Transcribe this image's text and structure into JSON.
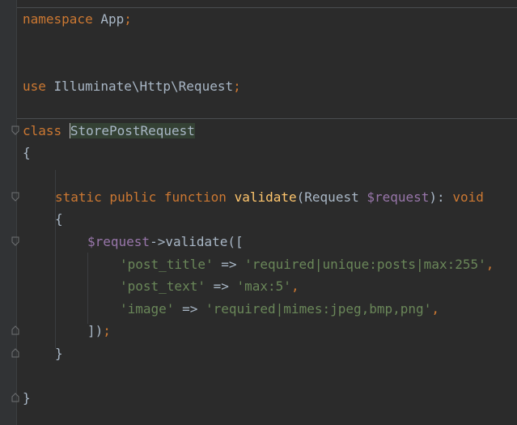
{
  "editor": {
    "lines": {
      "namespace_kw": "namespace",
      "namespace_name": " App",
      "namespace_semi": ";",
      "use_kw": "use",
      "use_path": " Illuminate\\Http\\Request",
      "use_semi": ";",
      "class_kw": "class",
      "class_space": " ",
      "class_name": "StorePostRequest",
      "open_brace": "{",
      "method_static": "static",
      "method_public": " public",
      "method_function": " function",
      "method_space": " ",
      "method_name": "validate",
      "method_paren_open": "(",
      "method_param_type": "Request ",
      "method_param_var": "$request",
      "method_paren_close": ")",
      "method_colon": ": ",
      "method_return": "void",
      "method_open_brace": "{",
      "call_var": "$request",
      "call_arrow": "->",
      "call_name": "validate",
      "call_open": "([",
      "rule1_key": "'post_title'",
      "rule1_arrow": " => ",
      "rule1_value": "'required|unique:posts|max:255'",
      "rule1_comma": ",",
      "rule2_key": "'post_text'",
      "rule2_arrow": " => ",
      "rule2_value": "'max:5'",
      "rule2_comma": ",",
      "rule3_key": "'image'",
      "rule3_arrow": " => ",
      "rule3_value": "'required|mimes:jpeg,bmp,png'",
      "rule3_comma": ",",
      "call_close": "])",
      "call_semi": ";",
      "method_close_brace": "}",
      "class_close_brace": "}"
    }
  },
  "colors": {
    "background": "#2b2b2b",
    "keyword": "#cc7832",
    "function": "#ffc66d",
    "variable": "#9876aa",
    "string": "#6a8759",
    "text": "#a9b7c6"
  }
}
